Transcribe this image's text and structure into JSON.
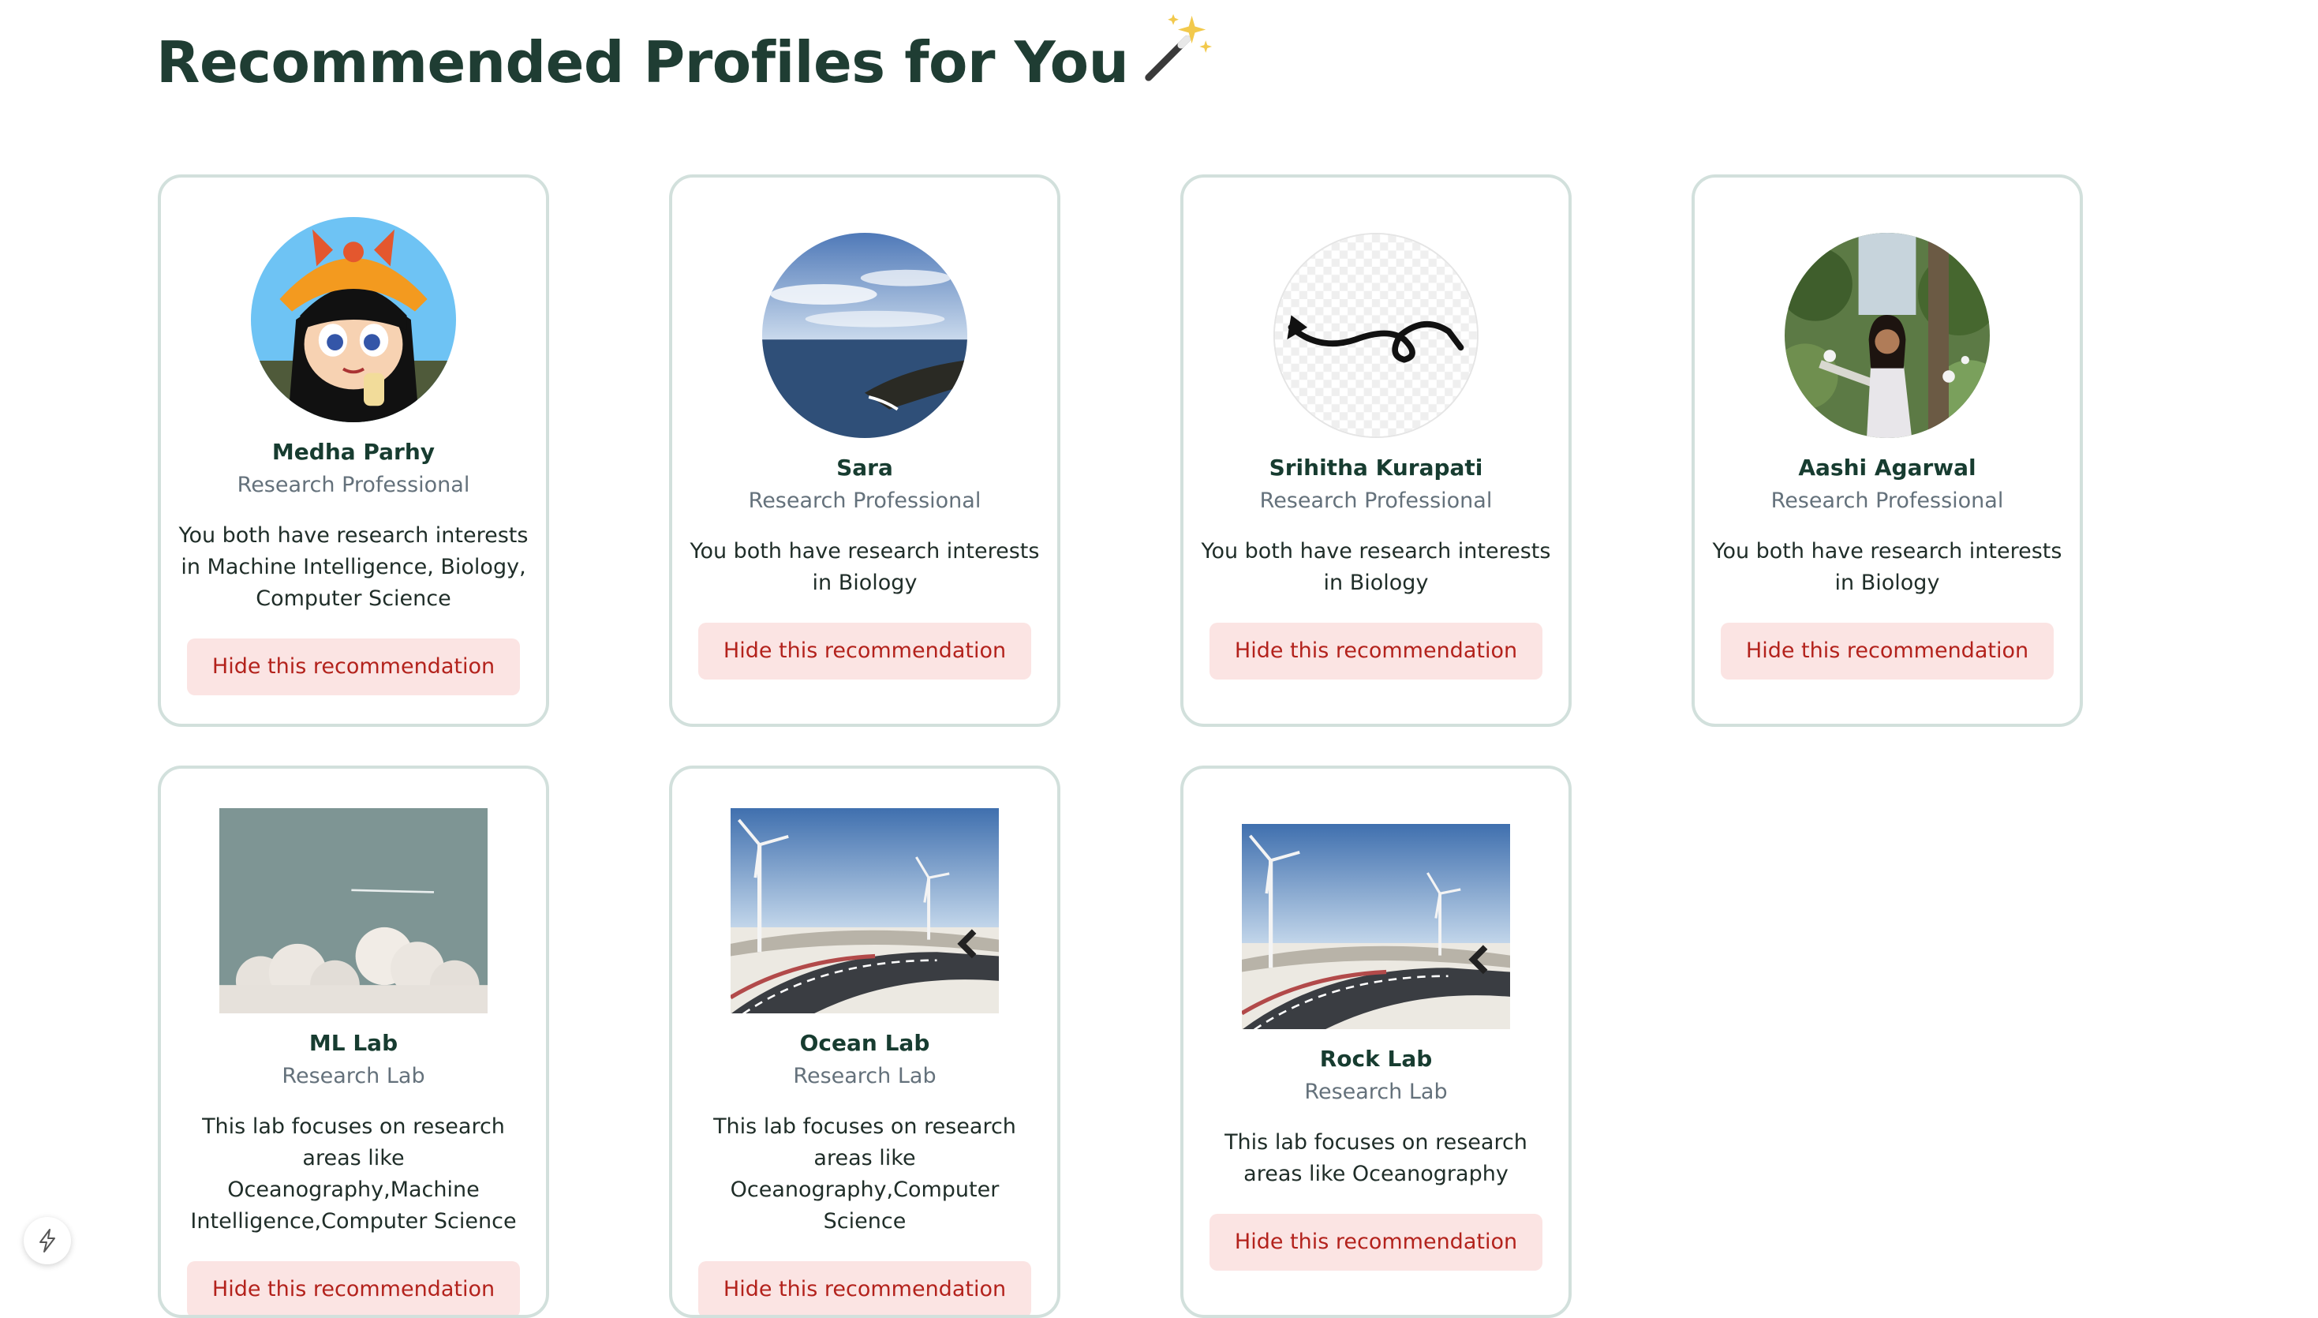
{
  "header": {
    "title": "Recommended Profiles for You",
    "title_icon": "magic-wand-icon"
  },
  "hide_label": "Hide this recommendation",
  "people": [
    {
      "name": "Medha Parhy",
      "role": "Research Professional",
      "description": "You both have research interests in Machine Intelligence, Biology, Computer Science",
      "avatar": "cartoon-girl-avatar"
    },
    {
      "name": "Sara",
      "role": "Research Professional",
      "description": "You both have research interests in Biology",
      "avatar": "ocean-cliff-avatar"
    },
    {
      "name": "Srihitha Kurapati",
      "role": "Research Professional",
      "description": "You both have research interests in Biology",
      "avatar": "squiggle-avatar"
    },
    {
      "name": "Aashi Agarwal",
      "role": "Research Professional",
      "description": "You both have research interests in Biology",
      "avatar": "garden-photo-avatar"
    }
  ],
  "labs": [
    {
      "name": "ML Lab",
      "role": "Research Lab",
      "description": "This lab focuses on research areas like Oceanography,Machine Intelligence,Computer Science",
      "image": "clouds-sky-image"
    },
    {
      "name": "Ocean Lab",
      "role": "Research Lab",
      "description": "This lab focuses on research areas like Oceanography,Computer Science",
      "image": "wind-turbine-road-image"
    },
    {
      "name": "Rock Lab",
      "role": "Research Lab",
      "description": "This lab focuses on research areas like Oceanography",
      "image": "wind-turbine-road-image"
    }
  ],
  "colors": {
    "accent": "#1f3d33",
    "button_bg": "#fbe4e3",
    "button_text": "#b3221c",
    "card_border": "#d2e0dc"
  },
  "floating_button_icon": "lightning-bolt-icon"
}
